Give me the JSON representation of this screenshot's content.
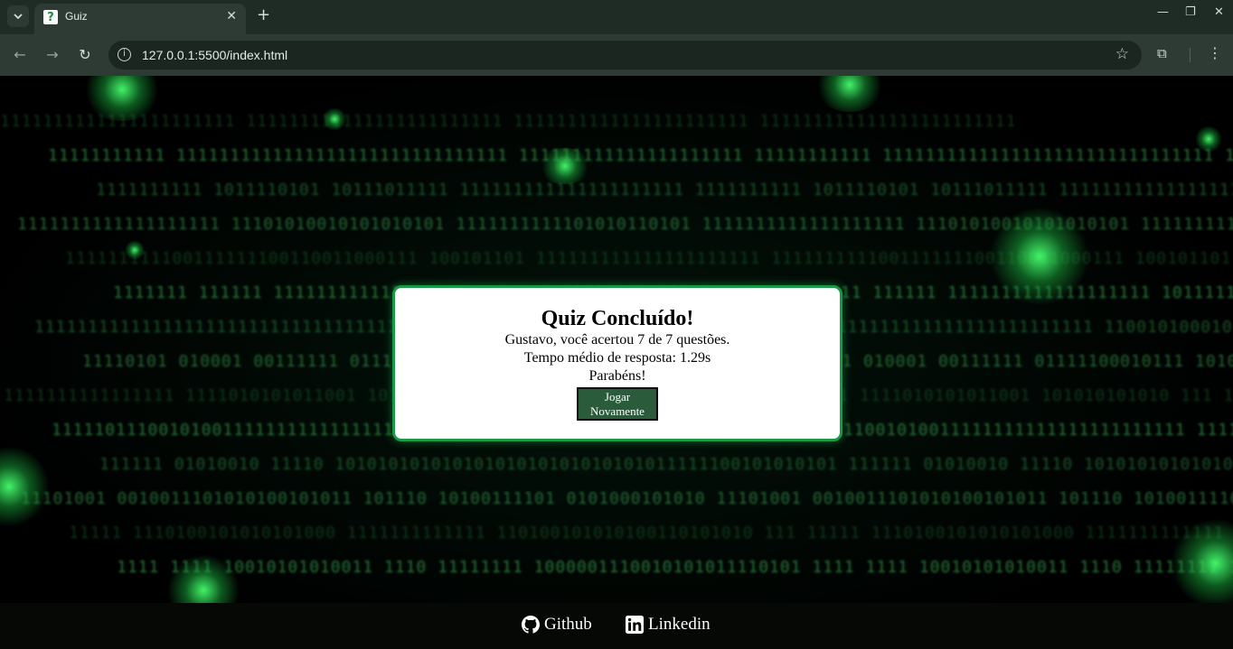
{
  "browser": {
    "tab_title": "Guiz",
    "tab_favicon": "?",
    "url": "127.0.0.1:5500/index.html",
    "icons": [
      "tab-search-icon",
      "close-icon",
      "new-tab-icon",
      "minimize-icon",
      "restore-icon",
      "window-close-icon",
      "back-icon",
      "forward-icon",
      "reload-icon",
      "site-info-icon",
      "star-icon",
      "extensions-icon",
      "menu-icon"
    ]
  },
  "background": {
    "matrix_rows": [
      "1111111111111111111111       111111111111111111111111",
      "11111111111   1111111111111111111111111111111   111111111111111111111",
      "1111111111    1011110101    10111011111    111111111111111111111",
      "1111111111111111111   11101010010101010101    1111111111101010110101",
      "111111111100111111100110011000111   100101101   111111111111111111111",
      "1111111  111111   1111111111111111111   101111101011001 111   1111111",
      "1111111111111111111111111111111111   1100101000101010  1101   1111111",
      "11110101  010001   00111111   01111100010111   101011101  11  1111111111",
      "1111111111111111    1111010101011001   101010101010  111   11111111111",
      "111110111001010011111111111111111111111   111111111111111  1111  11111",
      "111111  01010010   11110  10101010101010101010101010101011111100101010101",
      "  11101001   0010011101010100101011   101110   10100111101   0101000101010",
      "11111  1110100101010101000   1111111111111   110100101010100110101010  111",
      "1111 1111  10010101010011   1110   11111111   1000001110010101011110101"
    ],
    "colors": {
      "matrix": "#2f8a45",
      "glow": "#46ff6e"
    }
  },
  "modal": {
    "title": "Quiz Concluído!",
    "line1": "Gustavo, você acertou 7 de 7 questões.",
    "line2": "Tempo médio de resposta: 1.29s",
    "line3": "Parabéns!",
    "button_line1": "Jogar",
    "button_line2": "Novamente",
    "border_color": "#1a9a47",
    "button_color": "#2a5c3c"
  },
  "footer": {
    "github_label": "Github",
    "linkedin_label": "Linkedin",
    "icons": [
      "github-icon",
      "linkedin-icon"
    ]
  }
}
